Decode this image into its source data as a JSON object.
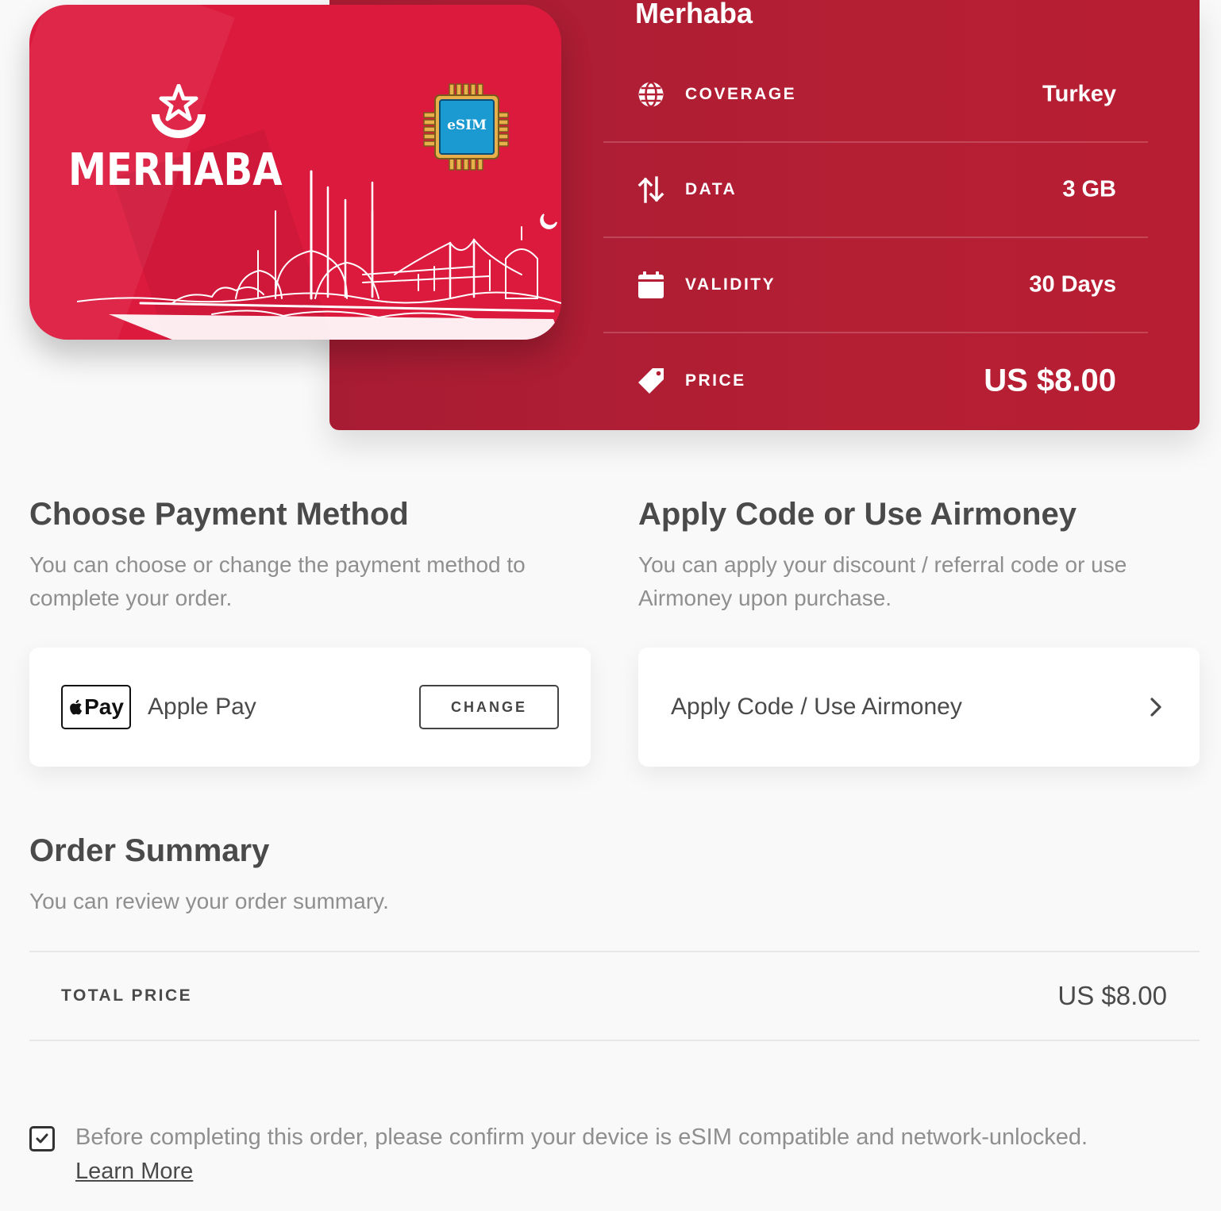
{
  "package": {
    "name": "Merhaba",
    "specs": {
      "coverage": {
        "label": "COVERAGE",
        "value": "Turkey",
        "icon": "globe-icon"
      },
      "data": {
        "label": "DATA",
        "value": "3 GB",
        "icon": "up-down-arrows-icon"
      },
      "validity": {
        "label": "VALIDITY",
        "value": "30 Days",
        "icon": "calendar-icon"
      },
      "price": {
        "label": "PRICE",
        "value": "US $8.00",
        "icon": "price-tag-icon"
      }
    },
    "colors": {
      "panel": "#b41f34",
      "card": "#dc1a3e"
    }
  },
  "esim_card": {
    "brand": "MERHABA",
    "chip_label": "eSIM",
    "emblem_icon": "star-crescent-icon",
    "chip_icon": "esim-chip-icon",
    "art": "istanbul-skyline-sketch"
  },
  "payment": {
    "title": "Choose Payment Method",
    "description": "You can choose or change the payment method to complete your order.",
    "badge_text": "Pay",
    "method_name": "Apple Pay",
    "change_label": "CHANGE"
  },
  "code": {
    "title": "Apply Code or Use Airmoney",
    "description": "You can apply your discount / referral code or use Airmoney upon purchase.",
    "button_label": "Apply Code / Use Airmoney"
  },
  "summary": {
    "title": "Order Summary",
    "description": "You can review your order summary.",
    "total_label": "TOTAL PRICE",
    "total_value": "US $8.00"
  },
  "confirmation": {
    "checked": true,
    "text": "Before completing this order, please confirm your device is eSIM compatible and network-unlocked.",
    "link_label": "Learn More"
  }
}
